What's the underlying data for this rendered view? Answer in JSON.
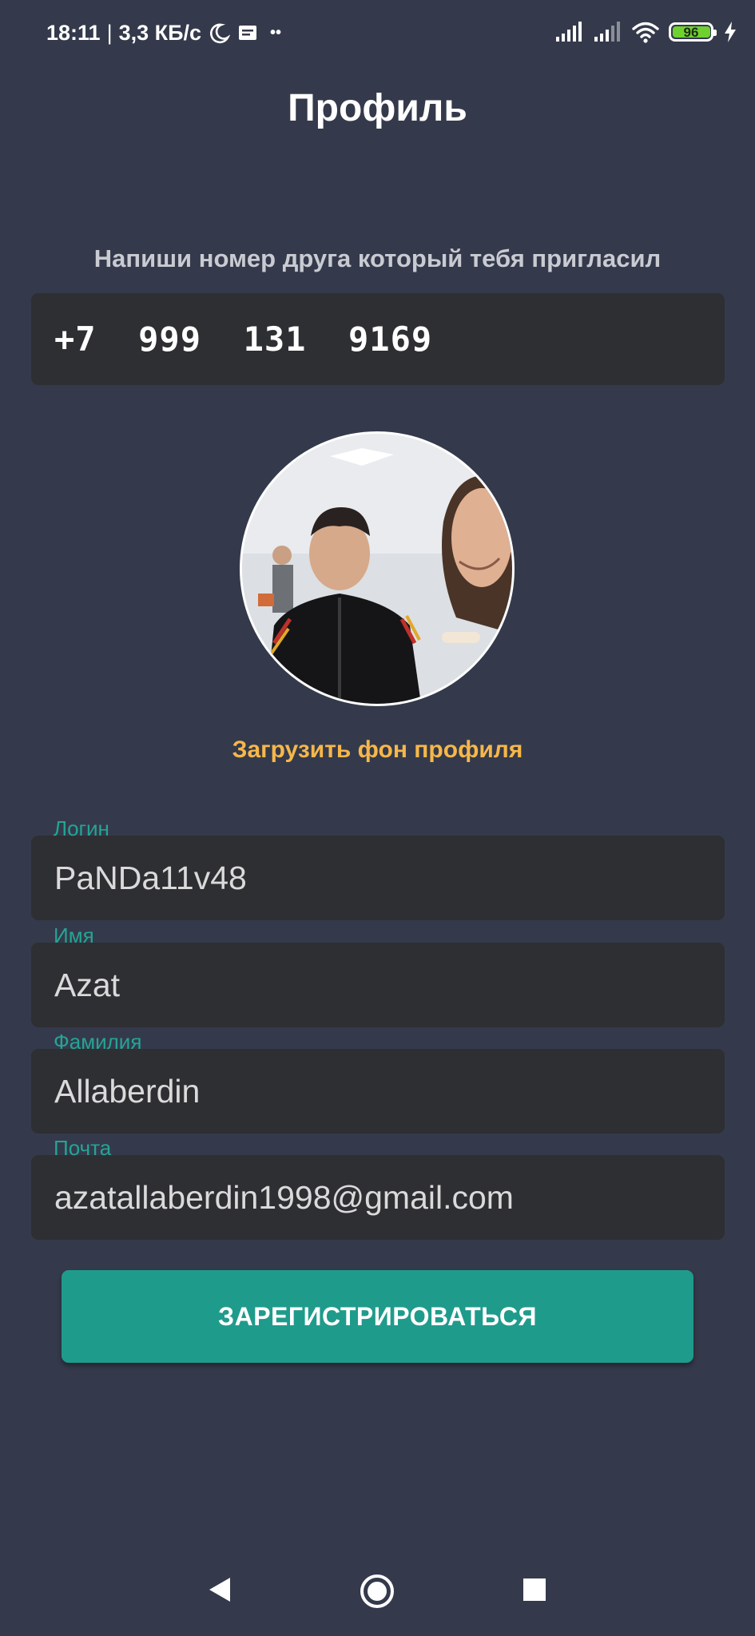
{
  "status_bar": {
    "time": "18:11",
    "separator": "|",
    "speed": "3,3 КБ/с",
    "dots": "••",
    "battery_level": "96",
    "battery_color": "#6fd12f",
    "icons": [
      "moon-icon",
      "notification-icon",
      "signal-icon",
      "signal-icon",
      "wifi-icon",
      "battery-icon",
      "charging-icon"
    ]
  },
  "header": {
    "title": "Профиль"
  },
  "invite": {
    "label": "Напиши номер друга который тебя пригласил",
    "phone_value": "+7  999  131  9169"
  },
  "avatar": {
    "icon": "avatar-photo"
  },
  "upload_background_label": "Загрузить фон профиля",
  "form": {
    "login": {
      "label": "Логин",
      "value": "PaNDa11v48"
    },
    "first_name": {
      "label": "Имя",
      "value": "Azat"
    },
    "last_name": {
      "label": "Фамилия",
      "value": "Allaberdin"
    },
    "email": {
      "label": "Почта",
      "value": "azatallaberdin1998@gmail.com"
    }
  },
  "submit_label": "ЗАРЕГИСТРИРОВАТЬСЯ",
  "colors": {
    "background": "#343a4b",
    "field": "#2e2f33",
    "accent": "#1f9b8c",
    "label": "#25a494",
    "link": "#f6b74a"
  },
  "nav": {
    "icons": [
      "back-icon",
      "home-icon",
      "recents-icon"
    ]
  }
}
